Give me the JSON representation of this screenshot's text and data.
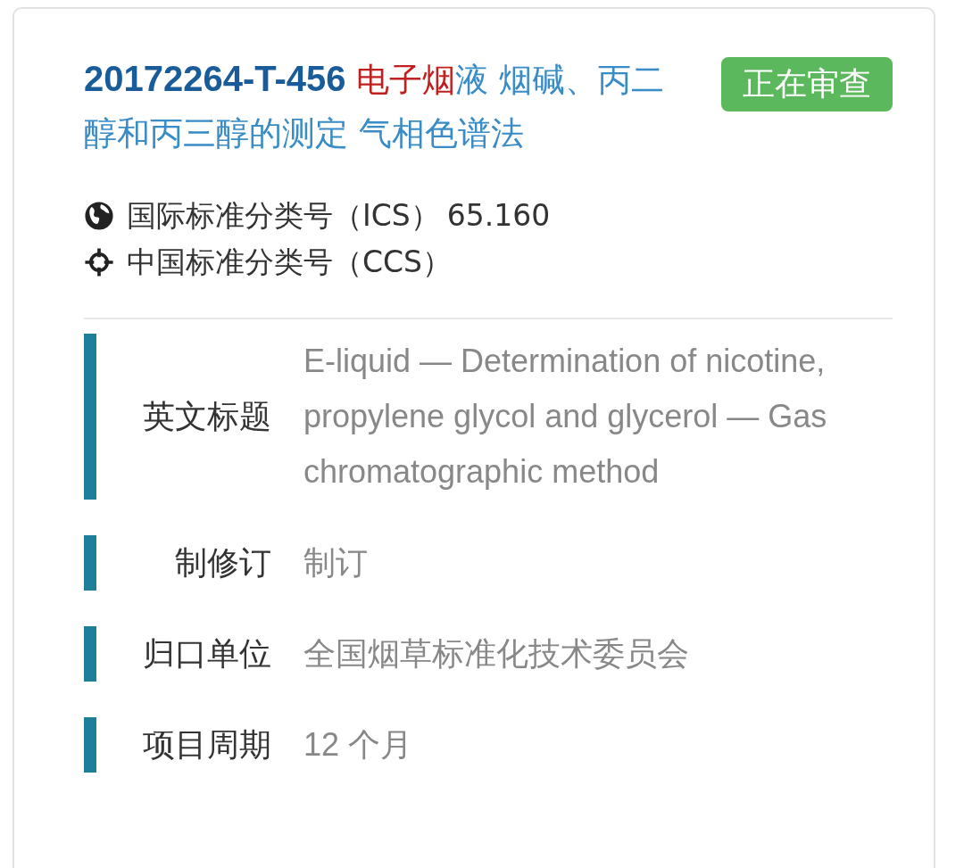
{
  "record": {
    "code": "20172264-T-456",
    "title_highlight": "电子烟",
    "title_rest": "液 烟碱、丙二醇和丙三醇的测定 气相色谱法",
    "status": "正在审查"
  },
  "classifications": [
    {
      "kind": "ics",
      "label": "国际标准分类号（ICS）",
      "value": "65.160"
    },
    {
      "kind": "ccs",
      "label": "中国标准分类号（CCS）"
    }
  ],
  "fields": [
    {
      "label": "英文标题",
      "value": "E-liquid — Determination of nicotine, propylene glycol and glycerol — Gas chromatographic method"
    },
    {
      "label": "制修订",
      "value": "制订"
    },
    {
      "label": "归口单位",
      "value": "全国烟草标准化技术委员会"
    },
    {
      "label": "项目周期",
      "value": "12 个月"
    }
  ]
}
